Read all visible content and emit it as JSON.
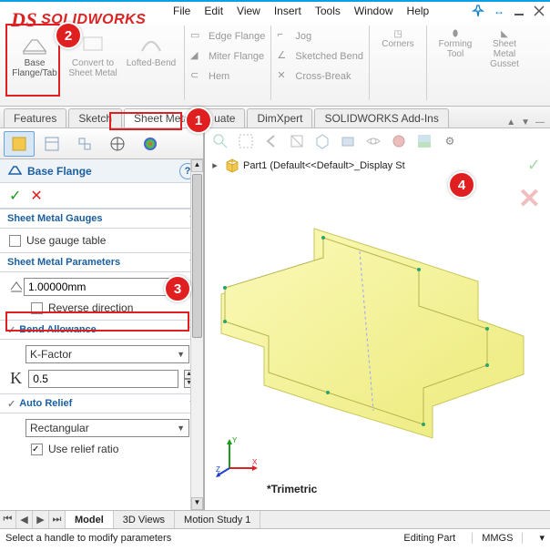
{
  "app": {
    "name": "SOLIDWORKS"
  },
  "menu": {
    "file": "File",
    "edit": "Edit",
    "view": "View",
    "insert": "Insert",
    "tools": "Tools",
    "window": "Window",
    "help": "Help"
  },
  "ribbon": {
    "base_flange": "Base\nFlange/Tab",
    "convert": "Convert to Sheet Metal",
    "lofted": "Lofted-Bend",
    "edge_flange": "Edge Flange",
    "miter_flange": "Miter Flange",
    "hem": "Hem",
    "jog": "Jog",
    "sketched_bend": "Sketched Bend",
    "cross_break": "Cross-Break",
    "corners": "Corners",
    "forming": "Forming Tool",
    "gusset": "Sheet Metal Gusset"
  },
  "tabs": {
    "features": "Features",
    "sketch": "Sketch",
    "sheet_metal": "Sheet Metal",
    "evaluate": "uate",
    "dimxpert": "DimXpert",
    "addins": "SOLIDWORKS Add-Ins"
  },
  "panel": {
    "title": "Base Flange",
    "sec_gauges": "Sheet Metal Gauges",
    "use_gauge": "Use gauge table",
    "sec_params": "Sheet Metal Parameters",
    "thickness": "1.00000mm",
    "reverse": "Reverse direction",
    "sec_bend": "Bend Allowance",
    "bend_method": "K-Factor",
    "k_value": "0.5",
    "sec_relief": "Auto Relief",
    "relief_type": "Rectangular",
    "use_relief": "Use relief ratio"
  },
  "tree": {
    "part": "Part1  (Default<<Default>_Display St"
  },
  "viewport": {
    "label": "*Trimetric"
  },
  "bottom": {
    "model": "Model",
    "views3d": "3D Views",
    "motion": "Motion Study 1"
  },
  "status": {
    "hint": "Select a handle to modify parameters",
    "mode": "Editing Part",
    "units": "MMGS"
  },
  "markers": {
    "m1": "1",
    "m2": "2",
    "m3": "3",
    "m4": "4"
  }
}
